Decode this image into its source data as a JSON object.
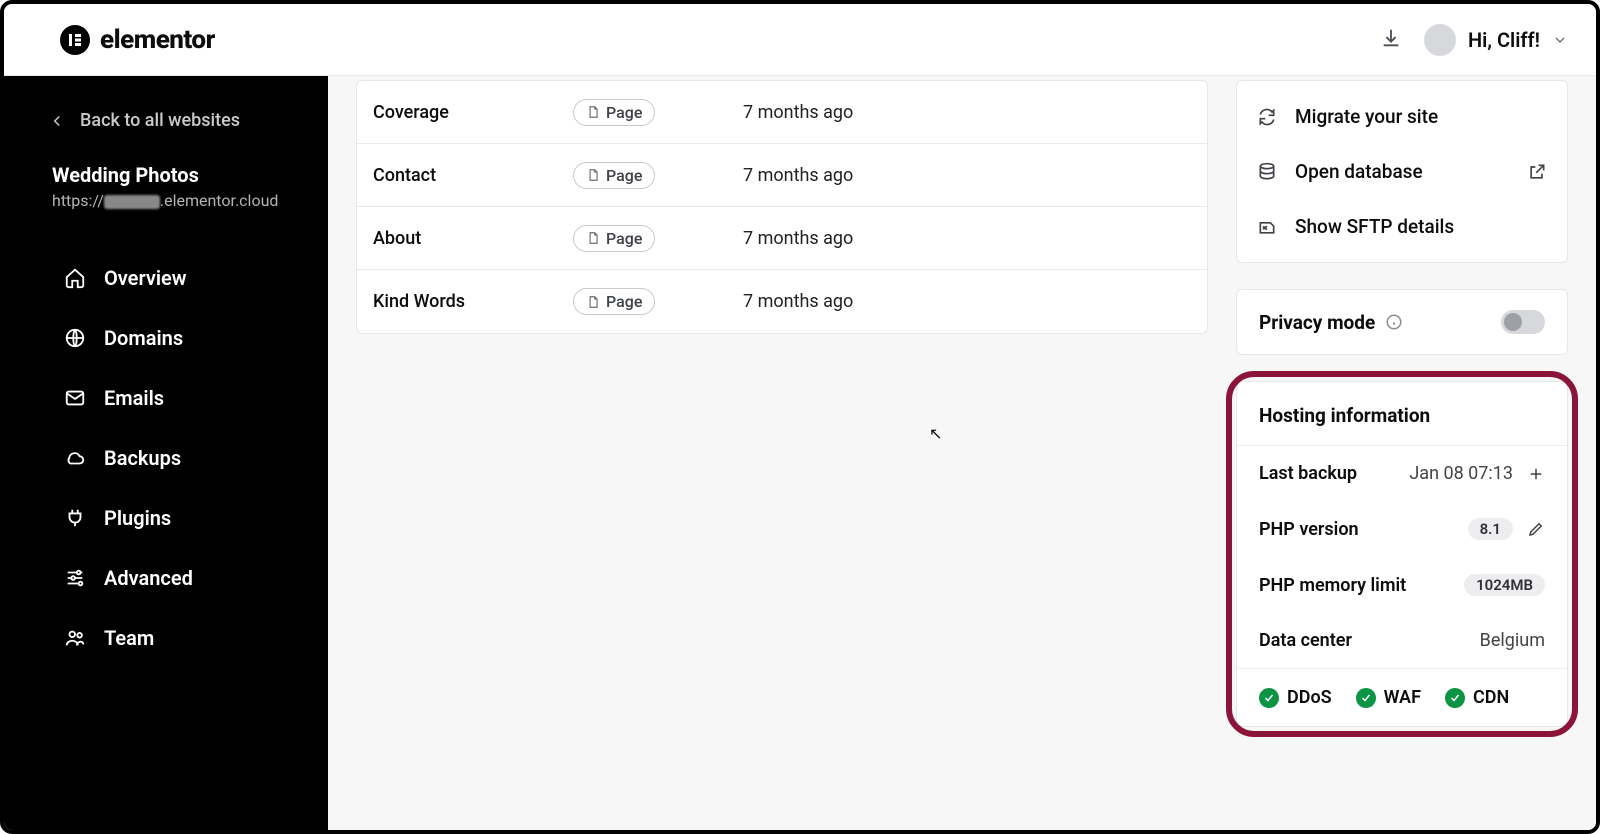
{
  "header": {
    "brand": "elementor",
    "greeting": "Hi, Cliff!"
  },
  "sidebar": {
    "back_label": "Back to all websites",
    "site_name": "Wedding Photos",
    "site_url_prefix": "https://",
    "site_url_suffix": ".elementor.cloud",
    "nav": {
      "overview": "Overview",
      "domains": "Domains",
      "emails": "Emails",
      "backups": "Backups",
      "plugins": "Plugins",
      "advanced": "Advanced",
      "team": "Team"
    }
  },
  "pages": {
    "type_label": "Page",
    "rows": [
      {
        "name": "Coverage",
        "date": "7 months ago"
      },
      {
        "name": "Contact",
        "date": "7 months ago"
      },
      {
        "name": "About",
        "date": "7 months ago"
      },
      {
        "name": "Kind Words",
        "date": "7 months ago"
      }
    ]
  },
  "tools": {
    "migrate": "Migrate your site",
    "open_db": "Open database",
    "sftp": "Show SFTP details"
  },
  "privacy": {
    "label": "Privacy mode"
  },
  "hosting": {
    "heading": "Hosting information",
    "last_backup_label": "Last backup",
    "last_backup_value": "Jan 08 07:13",
    "php_version_label": "PHP version",
    "php_version_value": "8.1",
    "php_mem_label": "PHP memory limit",
    "php_mem_value": "1024MB",
    "datacenter_label": "Data center",
    "datacenter_value": "Belgium",
    "sec": {
      "ddos": "DDoS",
      "waf": "WAF",
      "cdn": "CDN"
    }
  }
}
